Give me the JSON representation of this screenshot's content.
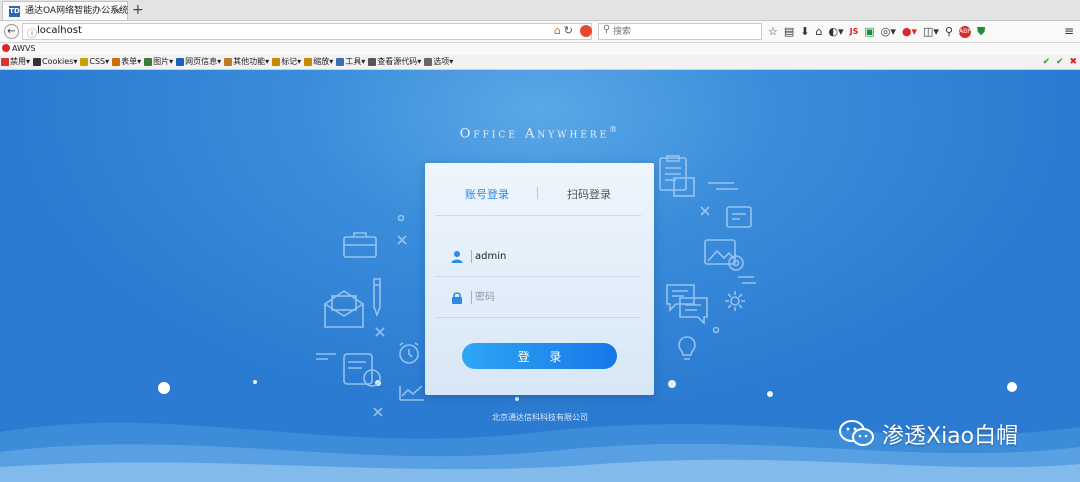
{
  "browser": {
    "tab_title": "通达OA网络智能办公系统",
    "tab_favicon": "TD",
    "new_tab": "+",
    "url": "localhost",
    "search_placeholder": "搜索",
    "js_badge": "JS",
    "abp_badge": "ABP"
  },
  "bookmarks": {
    "awvs": "AWVS"
  },
  "devtoolbar": {
    "items": [
      "禁用▾",
      "Cookies▾",
      "CSS▾",
      "表单▾",
      "图片▾",
      "网页信息▾",
      "其他功能▾",
      "标记▾",
      "缩放▾",
      "工具▾",
      "查看源代码▾",
      "选项▾"
    ],
    "item_colors": [
      "#d33",
      "#333",
      "#c8a000",
      "#cf6b00",
      "#3a7a3a",
      "#1d5fbf",
      "#c07a20",
      "#c58a00",
      "#c58a00",
      "#3b6fb5",
      "#555",
      "#666"
    ]
  },
  "page": {
    "brand": "Office Anywhere",
    "brand_mark": "®",
    "tab_account": "账号登录",
    "tab_qrcode": "扫码登录",
    "username_value": "admin",
    "password_placeholder": "密码",
    "login_button": "登 录",
    "copyright": "北京通达信科科技有限公司",
    "watermark": "渗透Xiao白帽"
  },
  "colors": {
    "accent": "#2d8ae6",
    "page_bg": "#2b7bd2",
    "button_from": "#2fa6f4",
    "button_to": "#1677e8"
  }
}
